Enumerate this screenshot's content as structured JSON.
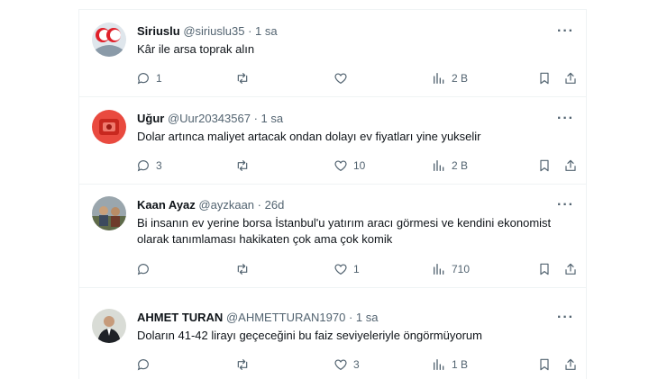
{
  "tweets": [
    {
      "name": "Siriuslu",
      "handle": "@siriuslu35",
      "time": "· 1 sa",
      "text": "Kâr ile arsa toprak alın",
      "replies": "1",
      "retweets": "",
      "likes": "",
      "views": "2 B"
    },
    {
      "name": "Uğur",
      "handle": "@Uur20343567",
      "time": "· 1 sa",
      "text": "Dolar artınca maliyet artacak ondan dolayı ev fiyatları yine yukselir",
      "replies": "3",
      "retweets": "",
      "likes": "10",
      "views": "2 B"
    },
    {
      "name": "Kaan Ayaz",
      "handle": "@ayzkaan",
      "time": "· 26d",
      "text": "Bi insanın ev yerine borsa İstanbul'u yatırım aracı görmesi ve kendini ekonomist olarak tanımlaması hakikaten çok ama çok komik",
      "replies": "",
      "retweets": "",
      "likes": "1",
      "views": "710"
    },
    {
      "name": "AHMET TURAN",
      "handle": "@AHMETTURAN1970",
      "time": "· 1 sa",
      "text": "Doların 41-42 lirayı geçeceğini bu faiz seviyeleriyle öngörmüyorum",
      "replies": "",
      "retweets": "",
      "likes": "3",
      "views": "1 B"
    }
  ],
  "icons": {
    "reply": "reply-icon",
    "retweet": "retweet-icon",
    "like": "heart-icon",
    "views": "views-icon",
    "bookmark": "bookmark-icon",
    "share": "share-icon",
    "more": "more-icon"
  },
  "colors": {
    "text": "#0f1419",
    "secondary": "#536471",
    "divider": "#eff3f4"
  }
}
